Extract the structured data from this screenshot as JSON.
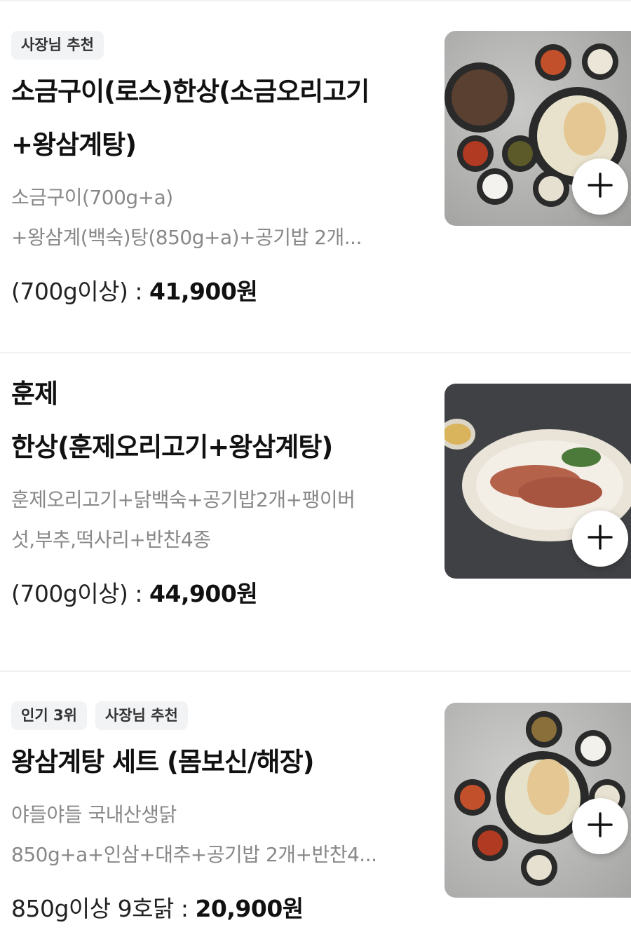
{
  "menu_items": [
    {
      "badges": [
        "사장님 추천"
      ],
      "title": [
        "소금구이(로스)한상(소금오리고기",
        "+왕삼계탕)"
      ],
      "description": [
        "소금구이(700g+a)",
        "+왕삼계(백숙)탕(850g+a)+공기밥 2개..."
      ],
      "price_label": "(700g이상) : ",
      "price": "41,900원",
      "image": "duck-salt-grill-set-photo"
    },
    {
      "badges": [],
      "title": [
        "훈제",
        "한상(훈제오리고기+왕삼계탕)"
      ],
      "description": [
        "훈제오리고기+닭백숙+공기밥2개+팽이버",
        "섯,부추,떡사리+반찬4종"
      ],
      "price_label": "(700g이상) : ",
      "price": "44,900원",
      "image": "smoked-duck-plate-photo"
    },
    {
      "badges": [
        "인기 3위",
        "사장님 추천"
      ],
      "title": [
        "왕삼계탕 세트 (몸보신/해장)"
      ],
      "description": [
        "야들야들 국내산생닭",
        "850g+a+인삼+대추+공기밥 2개+반찬4..."
      ],
      "price_label": "850g이상 9호닭 : ",
      "price": "20,900원",
      "image": "samgyetang-set-photo"
    }
  ],
  "icons": {
    "add": "plus-icon"
  },
  "colors": {
    "badge_bg": "#f2f3f5",
    "desc_text": "#888888",
    "divider": "#f1f1f1"
  }
}
